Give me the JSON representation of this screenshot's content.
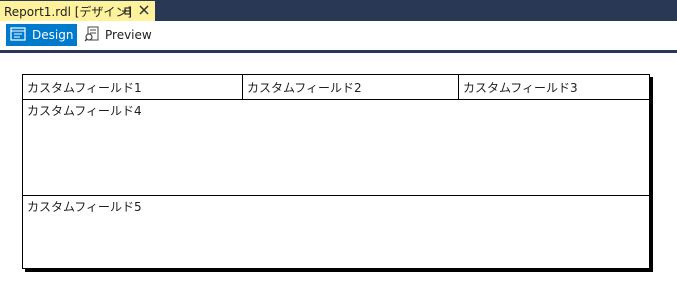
{
  "tab": {
    "title": "Report1.rdl [デザイン]",
    "pin_glyph": "⊣",
    "close_icon": "close-icon",
    "active_bg": "#fff29d"
  },
  "toolbar": {
    "design_label": "Design",
    "preview_label": "Preview",
    "accent": "#007acc"
  },
  "report": {
    "header_fields": [
      "カスタムフィールド1",
      "カスタムフィールド2",
      "カスタムフィールド3"
    ],
    "field4": "カスタムフィールド4",
    "field5": "カスタムフィールド5"
  }
}
